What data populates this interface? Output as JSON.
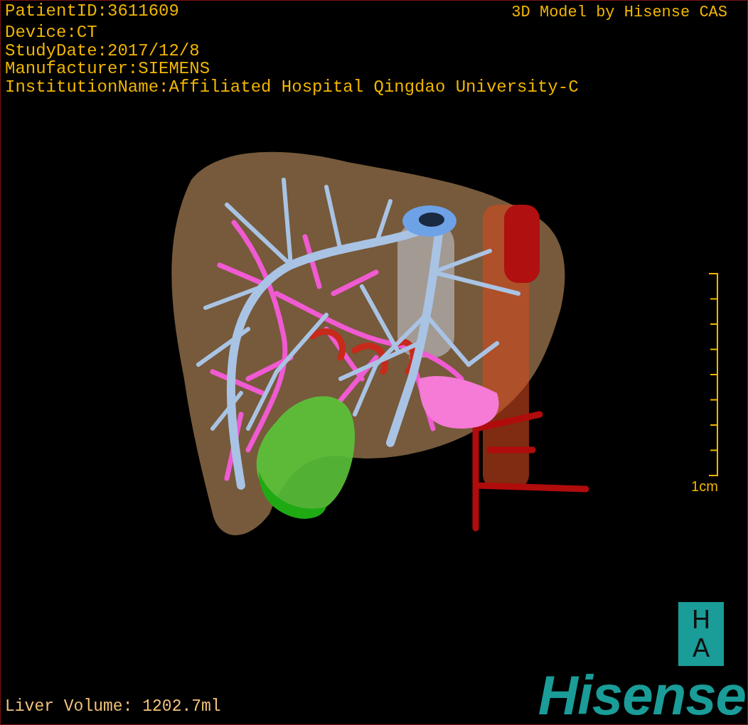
{
  "header": {
    "info_lines": [
      "PatientID:3611609",
      "Device:CT",
      "StudyDate:2017/12/8",
      "Manufacturer:SIEMENS",
      "InstitutionName:Affiliated Hospital Qingdao University-C"
    ],
    "product_label": "3D Model by Hisense CAS"
  },
  "scale_bar": {
    "label": "1cm"
  },
  "footer": {
    "liver_volume": "Liver Volume: 1202.7ml"
  },
  "logo": {
    "badge_letters": [
      "H",
      "A"
    ],
    "wordmark": "Hisense"
  }
}
